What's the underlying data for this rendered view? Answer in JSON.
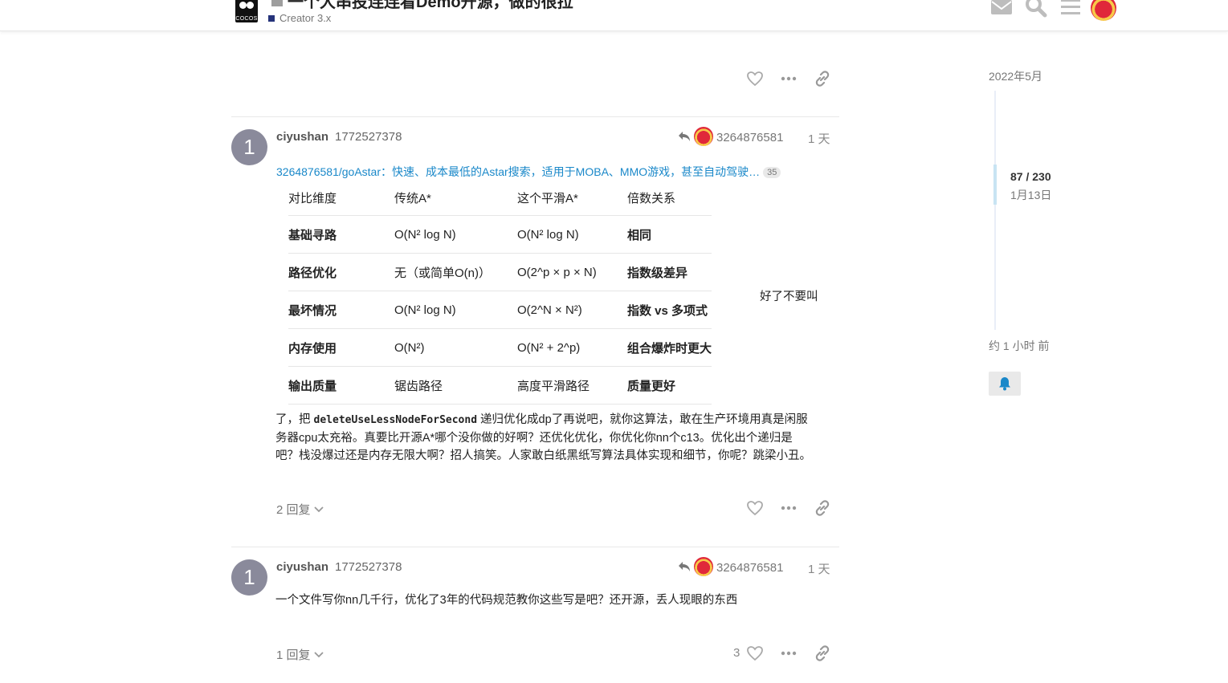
{
  "header": {
    "topic_title": "一个大串投连连看Demo开源，做的很拉",
    "category": "Creator 3.x",
    "logo_text": "COCOS",
    "icons": [
      "envelope-icon",
      "search-icon",
      "hamburger-menu-icon",
      "user-avatar"
    ]
  },
  "posts": [
    {
      "post_number": "1",
      "username": "ciyushan",
      "full_name": "1772527378",
      "reply_to": "3264876581",
      "time": "1 天",
      "onebox_link": "3264876581/goAstar：快速、成本最低的Astar搜索，适用于MOBA、MMO游戏，甚至自动驾驶…",
      "onebox_count": "35",
      "table": {
        "headers": [
          "对比维度",
          "传统A*",
          "这个平滑A*",
          "倍数关系"
        ],
        "rows": [
          [
            "基础寻路",
            "O(N² log N)",
            "O(N² log N)",
            "相同"
          ],
          [
            "路径优化",
            "无（或简单O(n)）",
            "O(2^p × p × N)",
            "指数级差异"
          ],
          [
            "最坏情况",
            "O(N² log N)",
            "O(2^N × N²)",
            "指数 vs 多项式"
          ],
          [
            "内存使用",
            "O(N²)",
            "O(N² + 2^p)",
            "组合爆炸时更大"
          ],
          [
            "输出质量",
            "锯齿路径",
            "高度平滑路径",
            "质量更好"
          ]
        ]
      },
      "side_note": "好了不要叫",
      "text_prefix": "了，把 ",
      "text_code": "deleteUseLessNodeForSecond",
      "text_rest_1": " 递归优化成dp了再说吧，就你这算法，敢在生产环境用真是闲服",
      "text_line_2": "务器cpu太充裕。真要比开源A*哪个没你做的好啊？还优化优化，你优化你nn个c13。优化出个递归是",
      "text_line_3": "吧？栈没爆过还是内存无限大啊？招人搞笑。人家敢白纸黑纸写算法具体实现和细节，你呢？跳梁小丑。",
      "replies": "2 回复"
    },
    {
      "post_number": "1",
      "username": "ciyushan",
      "full_name": "1772527378",
      "reply_to": "3264876581",
      "time": "1 天",
      "text": "一个文件写你nn几千行，优化了3年的代码规范教你这些写是吧？还开源，丢人现眼的东西",
      "replies": "1 回复",
      "likes": "3"
    }
  ],
  "timeline": {
    "top_date": "2022年5月",
    "position": "87 / 230",
    "position_date": "1月13日",
    "bottom_date": "约 1 小时 前"
  },
  "colors": {
    "accent_link": "#1a88c9",
    "avatar_gray": "#8a8a9b",
    "category_box": "#25337a"
  }
}
